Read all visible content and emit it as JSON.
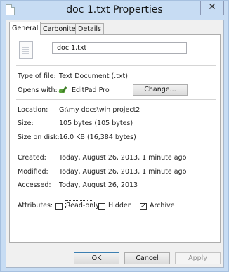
{
  "window": {
    "title": "doc  1.txt Properties",
    "close_glyph": "✕"
  },
  "tabs": [
    {
      "label": "General"
    },
    {
      "label": "Carbonite"
    },
    {
      "label": "Details"
    }
  ],
  "general": {
    "file_name": "doc  1.txt",
    "type_label": "Type of file:",
    "type_value": "Text Document (.txt)",
    "opens_label": "Opens with:",
    "opens_value": "EditPad Pro",
    "change_button": "Change...",
    "location_label": "Location:",
    "location_value": "G:\\my docs\\win project2",
    "size_label": "Size:",
    "size_value": "105 bytes (105 bytes)",
    "size_on_disk_label": "Size on disk:",
    "size_on_disk_value": "16.0 KB (16,384 bytes)",
    "created_label": "Created:",
    "created_value": "Today, August 26, 2013, 1 minute ago",
    "modified_label": "Modified:",
    "modified_value": "Today, August 26, 2013, 1 minute ago",
    "accessed_label": "Accessed:",
    "accessed_value": "Today, August 26, 2013",
    "attributes_label": "Attributes:",
    "read_only_label": "Read-only",
    "hidden_label": "Hidden",
    "archive_label": "Archive",
    "archive_check": "✓"
  },
  "buttons": {
    "ok": "OK",
    "cancel": "Cancel",
    "apply": "Apply"
  },
  "icons": {
    "app": "text-file-icon",
    "file": "document-icon",
    "opens_with": "editpad-icon",
    "close": "close-icon"
  }
}
